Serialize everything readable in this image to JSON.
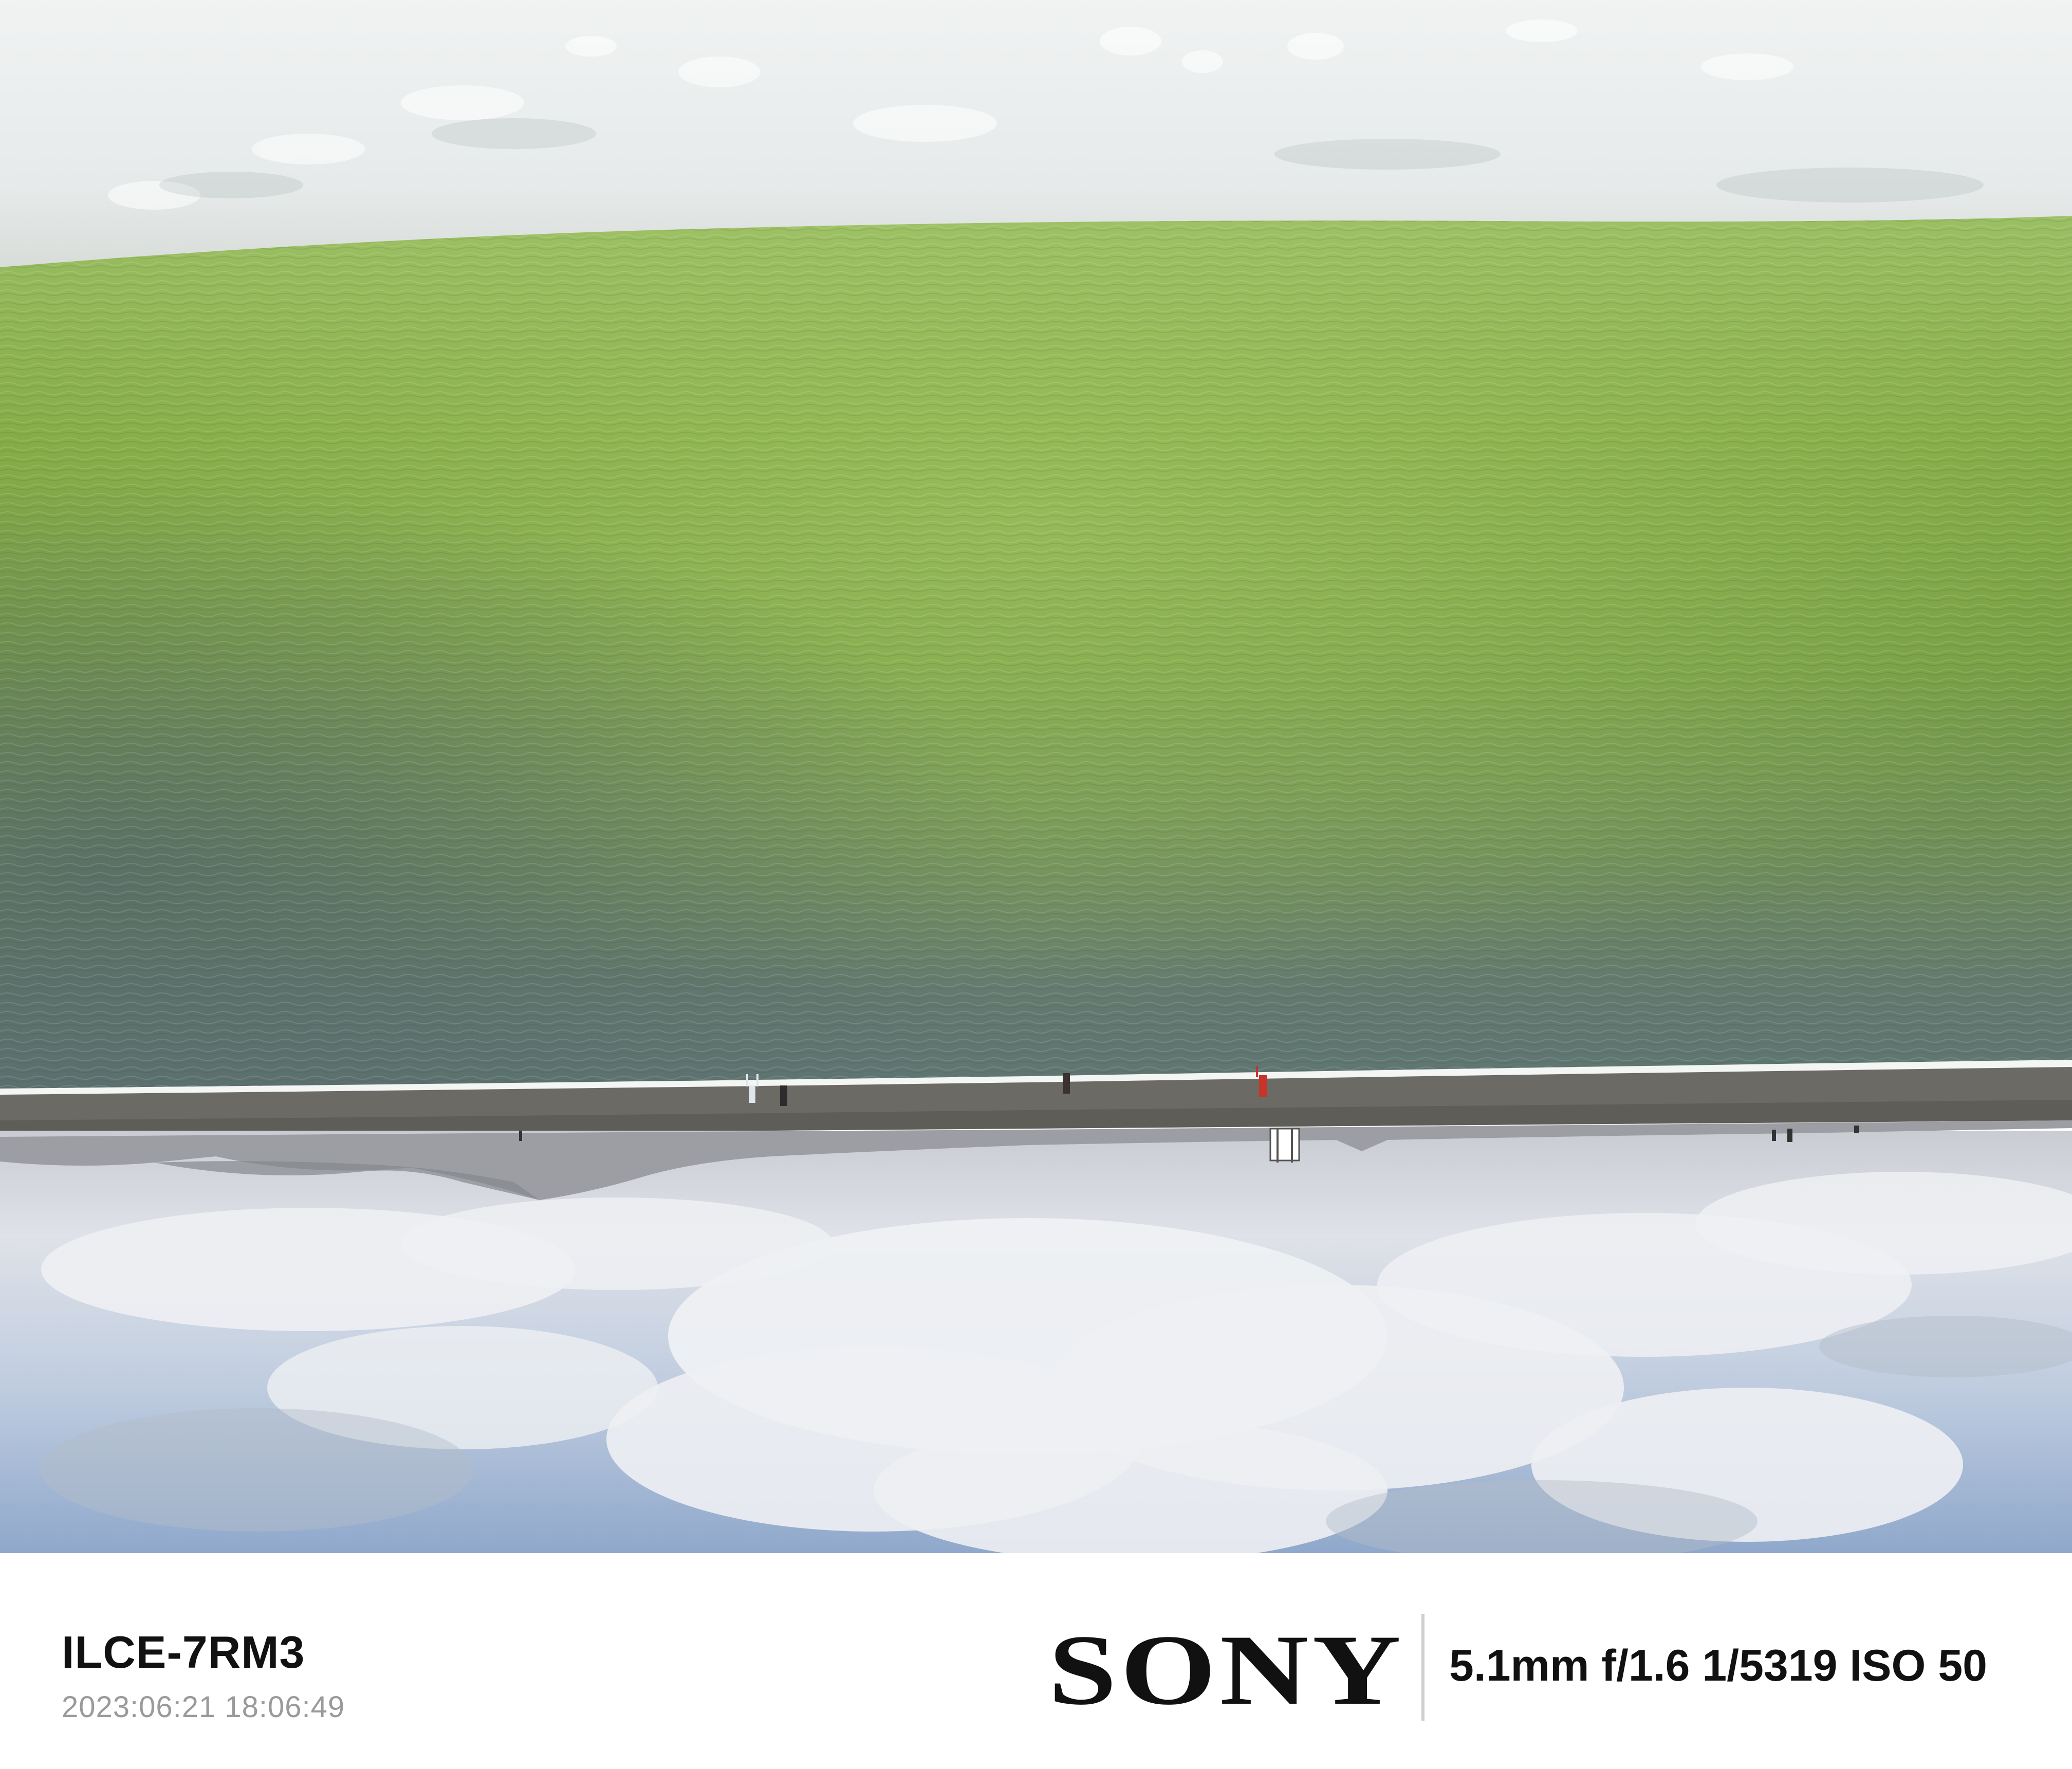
{
  "photo": {
    "description_icon": "landscape-photo",
    "orientation": "upside-down",
    "colors": {
      "salt_crust": "#e9ecec",
      "lake_green": "#7aa34a",
      "lake_dark": "#5f7571",
      "shore": "#6c6b66",
      "mountains": "#a6a8ae",
      "clouds": "#e6e9ee",
      "sky_blue": "#8ea7c8"
    }
  },
  "watermark": {
    "camera_model": "ILCE-7RM3",
    "capture_time": "2023:06:21 18:06:49",
    "brand": "SONY",
    "exif": "5.1mm f/1.6 1/5319 ISO 50"
  }
}
